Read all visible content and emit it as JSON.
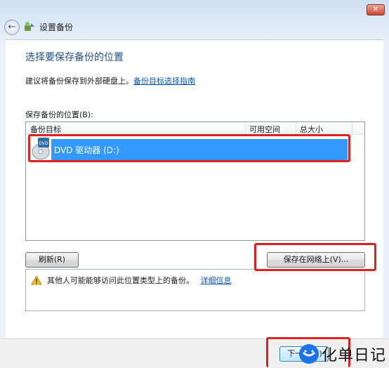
{
  "window": {
    "title": "设置备份",
    "close_glyph": "✕",
    "back_glyph": "←"
  },
  "main": {
    "heading": "选择要保存备份的位置",
    "description": "建议将备份保存到外部硬盘上。",
    "guide_link": "备份目标选择指南",
    "location_label": "保存备份的位置(B):"
  },
  "list": {
    "columns": [
      "备份目标",
      "可用空间",
      "总大小"
    ],
    "rows": [
      {
        "name": "DVD 驱动器 (D:)",
        "free": "",
        "total": ""
      }
    ]
  },
  "buttons": {
    "refresh": "刷新(R)",
    "save_network": "保存在网络上(V)...",
    "next": "下一步(N)"
  },
  "info": {
    "text": "其他人可能能够访问此位置类型上的备份。",
    "details_link": "详细信息"
  },
  "watermark": {
    "text": "化单日记"
  },
  "colors": {
    "selection": "#3399ff",
    "highlight": "#e0201e",
    "heading": "#1f4f8f",
    "link": "#0b57b9"
  }
}
